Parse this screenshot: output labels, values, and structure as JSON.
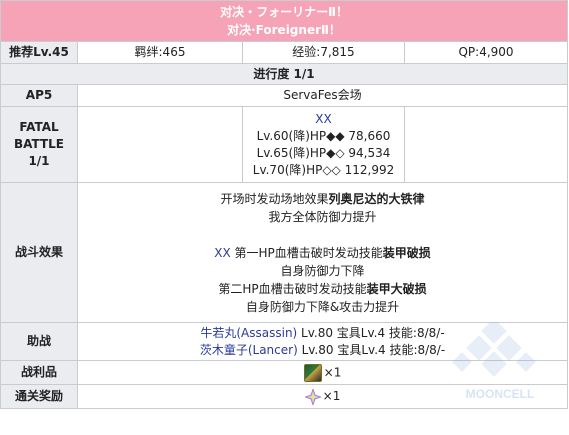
{
  "header": {
    "title_line1": "对决・フォーリナーⅡ！",
    "title_line2": "对决·ForeignerⅡ！"
  },
  "stats": {
    "level_label": "推荐Lv.45",
    "bond": "羁绊:465",
    "exp": "经验:7,815",
    "qp": "QP:4,900"
  },
  "progress": "进行度 1/1",
  "ap": {
    "label": "AP5",
    "location": "ServaFes会场"
  },
  "battle": {
    "label_lines": [
      "FATAL",
      "BATTLE",
      "1/1"
    ],
    "enemy_name": "XX",
    "hp_lines": [
      "Lv.60(降)HP◆◆ 78,660",
      "Lv.65(降)HP◆◇ 94,534",
      "Lv.70(降)HP◇◇ 112,992"
    ]
  },
  "effects": {
    "label": "战斗效果",
    "line1_prefix": "开场时发动场地效果",
    "line1_bold": "列奥尼达的大铁律",
    "line2": "我方全体防御力提升",
    "line3_name": "XX",
    "line3_text": " 第一HP血槽击破时发动技能",
    "line3_bold": "装甲破损",
    "line4": "自身防御力下降",
    "line5_text": "第二HP血槽击破时发动技能",
    "line5_bold": "装甲大破损",
    "line6": "自身防御力下降&攻击力提升"
  },
  "support": {
    "label": "助战",
    "items": [
      {
        "name": "牛若丸(Assassin)",
        "detail": " Lv.80 宝具Lv.4 技能:8/8/-"
      },
      {
        "name": "茨木童子(Lancer)",
        "detail": " Lv.80 宝具Lv.4 技能:8/8/-"
      }
    ]
  },
  "loot": {
    "label": "战利品",
    "count": "×1",
    "icon": "item-icon"
  },
  "reward": {
    "label": "通关奖励",
    "count": "×1",
    "icon": "saint-quartz-icon"
  },
  "watermark": {
    "text": "MOONCELL"
  },
  "colors": {
    "header_bg": "#f6a3b7",
    "label_bg": "#eaecf0",
    "link": "#2a3a9a",
    "border": "#c8ccd1"
  }
}
